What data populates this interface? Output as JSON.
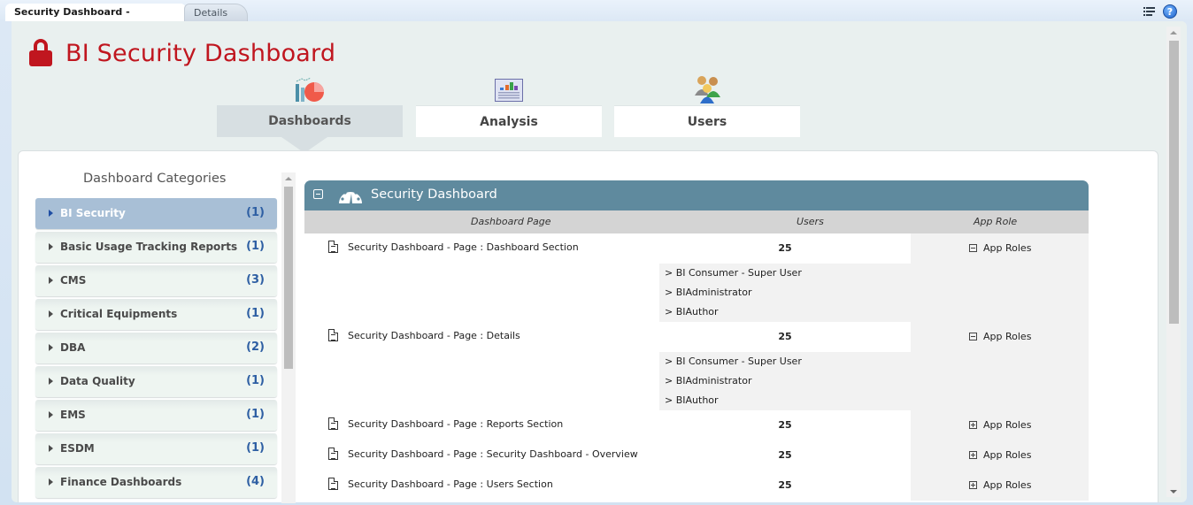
{
  "tabs": [
    {
      "label": "Security Dashboard - Overview",
      "active": true
    },
    {
      "label": "Details",
      "active": false
    }
  ],
  "top_icons": {
    "menu": "page-options-icon",
    "help": "help-icon",
    "help_glyph": "?"
  },
  "header": {
    "title": "BI Security Dashboard",
    "icon": "lock-icon",
    "accent_color": "#c0161f"
  },
  "nav": [
    {
      "label": "Dashboards",
      "icon": "dashboards-chart-icon",
      "active": true
    },
    {
      "label": "Analysis",
      "icon": "analysis-report-icon",
      "active": false
    },
    {
      "label": "Users",
      "icon": "users-group-icon",
      "active": false
    }
  ],
  "categories": {
    "title": "Dashboard Categories",
    "items": [
      {
        "label": "BI Security",
        "count": "(1)",
        "selected": true
      },
      {
        "label": "Basic Usage Tracking Reports",
        "count": "(1)"
      },
      {
        "label": "CMS",
        "count": "(3)"
      },
      {
        "label": "Critical Equipments",
        "count": "(1)"
      },
      {
        "label": "DBA",
        "count": "(2)"
      },
      {
        "label": "Data Quality",
        "count": "(1)"
      },
      {
        "label": "EMS",
        "count": "(1)"
      },
      {
        "label": "ESDM",
        "count": "(1)"
      },
      {
        "label": "Finance Dashboards",
        "count": "(4)"
      }
    ]
  },
  "dashboard_panel": {
    "title": "Security Dashboard",
    "header_color": "#5f8a9e",
    "columns": [
      "Dashboard Page",
      "Users",
      "App Role"
    ],
    "rows": [
      {
        "page": "Security Dashboard - Page : Dashboard Section",
        "users": "25",
        "app_role": "App Roles",
        "expanded": true,
        "roles": [
          "> BI Consumer - Super User",
          "> BIAdministrator",
          "> BIAuthor"
        ]
      },
      {
        "page": "Security Dashboard - Page : Details",
        "users": "25",
        "app_role": "App Roles",
        "expanded": true,
        "roles": [
          "> BI Consumer - Super User",
          "> BIAdministrator",
          "> BIAuthor"
        ]
      },
      {
        "page": "Security Dashboard - Page : Reports Section",
        "users": "25",
        "app_role": "App Roles",
        "expanded": false
      },
      {
        "page": "Security Dashboard - Page : Security Dashboard - Overview",
        "users": "25",
        "app_role": "App Roles",
        "expanded": false
      },
      {
        "page": "Security Dashboard - Page : Users Section",
        "users": "25",
        "app_role": "App Roles",
        "expanded": false
      }
    ]
  }
}
